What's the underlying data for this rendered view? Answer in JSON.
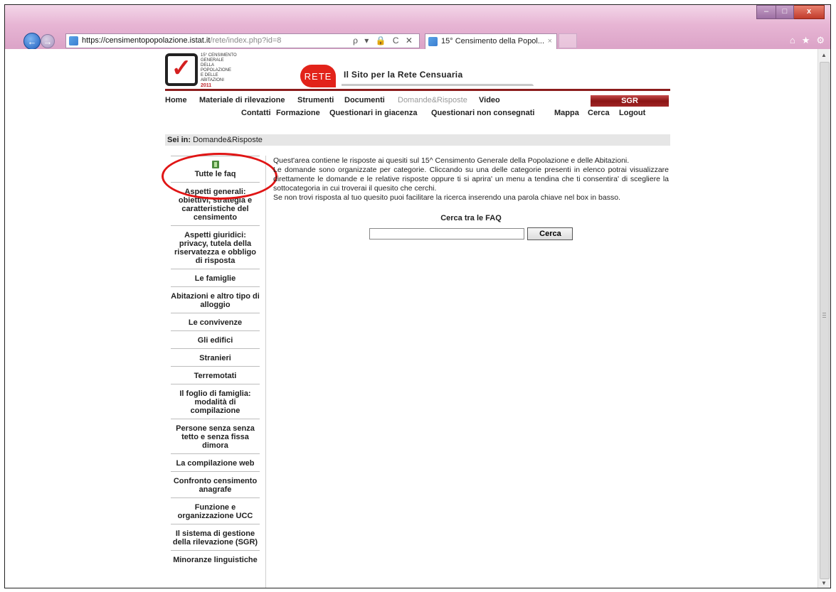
{
  "browser": {
    "url_host": "https://censimentopopolazione.istat.it",
    "url_path": "/rete/index.php?id=8",
    "tab_title": "15° Censimento della Popol...",
    "tab_close": "×",
    "address_tools": "ρ ▾ 🔒 C ✕",
    "window_buttons": {
      "minimize": "–",
      "maximize": "□",
      "close": "x"
    },
    "right_icons": [
      "⌂",
      "★",
      "⚙"
    ]
  },
  "site": {
    "logo_lines": [
      "15° CENSIMENTO GENERALE",
      "DELLA POPOLAZIONE",
      "E DELLE ABITAZIONI"
    ],
    "logo_year": "2011",
    "rete_badge": "RETE",
    "title": "Il Sito per la Rete Censuaria"
  },
  "menu_primary": [
    {
      "label": "Home"
    },
    {
      "label": "Materiale di rilevazione"
    },
    {
      "label": "Strumenti"
    },
    {
      "label": "Documenti"
    },
    {
      "label": "Domande&Risposte",
      "active": true
    },
    {
      "label": "Video"
    }
  ],
  "sgr_label": "SGR",
  "menu_secondary": [
    {
      "label": "Contatti"
    },
    {
      "label": "Formazione"
    },
    {
      "label": "Questionari in giacenza"
    },
    {
      "label": "Questionari non consegnati"
    },
    {
      "label": "Mappa"
    },
    {
      "label": "Cerca"
    },
    {
      "label": "Logout"
    }
  ],
  "breadcrumb": {
    "prefix": "Sei in:",
    "current": "Domande&Risposte"
  },
  "sidebar": {
    "first_item": "Tutte le faq",
    "items": [
      "Aspetti generali: obiettivi, strategia e caratteristiche del censimento",
      "Aspetti giuridici: privacy, tutela della riservatezza e obbligo di risposta",
      "Le famiglie",
      "Abitazioni e altro tipo di alloggio",
      "Le convivenze",
      "Gli edifici",
      "Stranieri",
      "Terremotati",
      "Il foglio di famiglia: modalità di compilazione",
      "Persone senza senza tetto e senza fissa dimora",
      "La compilazione web",
      "Confronto censimento anagrafe",
      "Funzione e organizzazione UCC",
      "Il sistema di gestione della rilevazione (SGR)",
      "Minoranze linguistiche"
    ]
  },
  "content": {
    "intro": "Quest'area contiene le risposte ai quesiti sul 15^ Censimento Generale della Popolazione e delle Abitazioni.",
    "p2": "Le domande sono organizzate per categorie. Cliccando su una delle categorie presenti in elenco potrai visualizzare direttamente le domande e le relative risposte oppure ti si aprira' un menu a tendina che ti consentira' di scegliere la sottocategoria in cui troverai il quesito che cerchi.",
    "p3": "Se non trovi risposta al tuo quesito puoi facilitare la ricerca inserendo una parola chiave nel box in basso.",
    "search_title": "Cerca tra le FAQ",
    "search_value": "",
    "search_button": "Cerca"
  },
  "colors": {
    "brand_red": "#e2231a",
    "rule_red": "#8c1d1d",
    "highlight": "#e01515"
  }
}
